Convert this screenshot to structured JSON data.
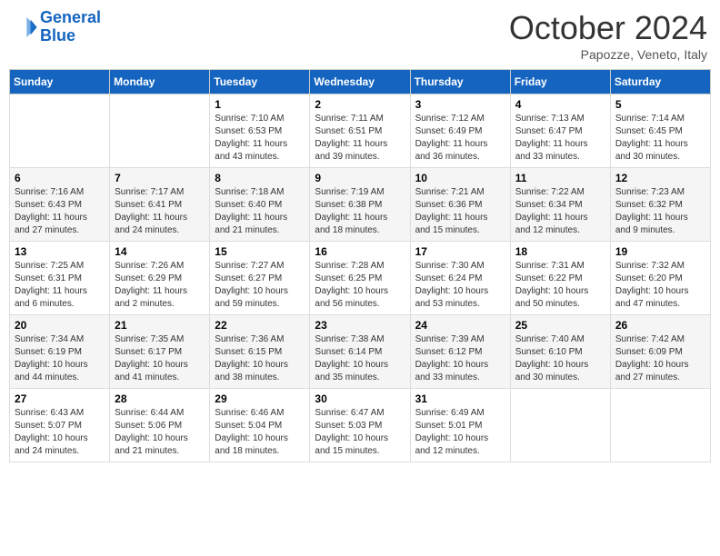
{
  "header": {
    "logo_general": "General",
    "logo_blue": "Blue",
    "month_title": "October 2024",
    "location": "Papozze, Veneto, Italy"
  },
  "days_of_week": [
    "Sunday",
    "Monday",
    "Tuesday",
    "Wednesday",
    "Thursday",
    "Friday",
    "Saturday"
  ],
  "weeks": [
    [
      {
        "day": "",
        "sunrise": "",
        "sunset": "",
        "daylight": ""
      },
      {
        "day": "",
        "sunrise": "",
        "sunset": "",
        "daylight": ""
      },
      {
        "day": "1",
        "sunrise": "Sunrise: 7:10 AM",
        "sunset": "Sunset: 6:53 PM",
        "daylight": "Daylight: 11 hours and 43 minutes."
      },
      {
        "day": "2",
        "sunrise": "Sunrise: 7:11 AM",
        "sunset": "Sunset: 6:51 PM",
        "daylight": "Daylight: 11 hours and 39 minutes."
      },
      {
        "day": "3",
        "sunrise": "Sunrise: 7:12 AM",
        "sunset": "Sunset: 6:49 PM",
        "daylight": "Daylight: 11 hours and 36 minutes."
      },
      {
        "day": "4",
        "sunrise": "Sunrise: 7:13 AM",
        "sunset": "Sunset: 6:47 PM",
        "daylight": "Daylight: 11 hours and 33 minutes."
      },
      {
        "day": "5",
        "sunrise": "Sunrise: 7:14 AM",
        "sunset": "Sunset: 6:45 PM",
        "daylight": "Daylight: 11 hours and 30 minutes."
      }
    ],
    [
      {
        "day": "6",
        "sunrise": "Sunrise: 7:16 AM",
        "sunset": "Sunset: 6:43 PM",
        "daylight": "Daylight: 11 hours and 27 minutes."
      },
      {
        "day": "7",
        "sunrise": "Sunrise: 7:17 AM",
        "sunset": "Sunset: 6:41 PM",
        "daylight": "Daylight: 11 hours and 24 minutes."
      },
      {
        "day": "8",
        "sunrise": "Sunrise: 7:18 AM",
        "sunset": "Sunset: 6:40 PM",
        "daylight": "Daylight: 11 hours and 21 minutes."
      },
      {
        "day": "9",
        "sunrise": "Sunrise: 7:19 AM",
        "sunset": "Sunset: 6:38 PM",
        "daylight": "Daylight: 11 hours and 18 minutes."
      },
      {
        "day": "10",
        "sunrise": "Sunrise: 7:21 AM",
        "sunset": "Sunset: 6:36 PM",
        "daylight": "Daylight: 11 hours and 15 minutes."
      },
      {
        "day": "11",
        "sunrise": "Sunrise: 7:22 AM",
        "sunset": "Sunset: 6:34 PM",
        "daylight": "Daylight: 11 hours and 12 minutes."
      },
      {
        "day": "12",
        "sunrise": "Sunrise: 7:23 AM",
        "sunset": "Sunset: 6:32 PM",
        "daylight": "Daylight: 11 hours and 9 minutes."
      }
    ],
    [
      {
        "day": "13",
        "sunrise": "Sunrise: 7:25 AM",
        "sunset": "Sunset: 6:31 PM",
        "daylight": "Daylight: 11 hours and 6 minutes."
      },
      {
        "day": "14",
        "sunrise": "Sunrise: 7:26 AM",
        "sunset": "Sunset: 6:29 PM",
        "daylight": "Daylight: 11 hours and 2 minutes."
      },
      {
        "day": "15",
        "sunrise": "Sunrise: 7:27 AM",
        "sunset": "Sunset: 6:27 PM",
        "daylight": "Daylight: 10 hours and 59 minutes."
      },
      {
        "day": "16",
        "sunrise": "Sunrise: 7:28 AM",
        "sunset": "Sunset: 6:25 PM",
        "daylight": "Daylight: 10 hours and 56 minutes."
      },
      {
        "day": "17",
        "sunrise": "Sunrise: 7:30 AM",
        "sunset": "Sunset: 6:24 PM",
        "daylight": "Daylight: 10 hours and 53 minutes."
      },
      {
        "day": "18",
        "sunrise": "Sunrise: 7:31 AM",
        "sunset": "Sunset: 6:22 PM",
        "daylight": "Daylight: 10 hours and 50 minutes."
      },
      {
        "day": "19",
        "sunrise": "Sunrise: 7:32 AM",
        "sunset": "Sunset: 6:20 PM",
        "daylight": "Daylight: 10 hours and 47 minutes."
      }
    ],
    [
      {
        "day": "20",
        "sunrise": "Sunrise: 7:34 AM",
        "sunset": "Sunset: 6:19 PM",
        "daylight": "Daylight: 10 hours and 44 minutes."
      },
      {
        "day": "21",
        "sunrise": "Sunrise: 7:35 AM",
        "sunset": "Sunset: 6:17 PM",
        "daylight": "Daylight: 10 hours and 41 minutes."
      },
      {
        "day": "22",
        "sunrise": "Sunrise: 7:36 AM",
        "sunset": "Sunset: 6:15 PM",
        "daylight": "Daylight: 10 hours and 38 minutes."
      },
      {
        "day": "23",
        "sunrise": "Sunrise: 7:38 AM",
        "sunset": "Sunset: 6:14 PM",
        "daylight": "Daylight: 10 hours and 35 minutes."
      },
      {
        "day": "24",
        "sunrise": "Sunrise: 7:39 AM",
        "sunset": "Sunset: 6:12 PM",
        "daylight": "Daylight: 10 hours and 33 minutes."
      },
      {
        "day": "25",
        "sunrise": "Sunrise: 7:40 AM",
        "sunset": "Sunset: 6:10 PM",
        "daylight": "Daylight: 10 hours and 30 minutes."
      },
      {
        "day": "26",
        "sunrise": "Sunrise: 7:42 AM",
        "sunset": "Sunset: 6:09 PM",
        "daylight": "Daylight: 10 hours and 27 minutes."
      }
    ],
    [
      {
        "day": "27",
        "sunrise": "Sunrise: 6:43 AM",
        "sunset": "Sunset: 5:07 PM",
        "daylight": "Daylight: 10 hours and 24 minutes."
      },
      {
        "day": "28",
        "sunrise": "Sunrise: 6:44 AM",
        "sunset": "Sunset: 5:06 PM",
        "daylight": "Daylight: 10 hours and 21 minutes."
      },
      {
        "day": "29",
        "sunrise": "Sunrise: 6:46 AM",
        "sunset": "Sunset: 5:04 PM",
        "daylight": "Daylight: 10 hours and 18 minutes."
      },
      {
        "day": "30",
        "sunrise": "Sunrise: 6:47 AM",
        "sunset": "Sunset: 5:03 PM",
        "daylight": "Daylight: 10 hours and 15 minutes."
      },
      {
        "day": "31",
        "sunrise": "Sunrise: 6:49 AM",
        "sunset": "Sunset: 5:01 PM",
        "daylight": "Daylight: 10 hours and 12 minutes."
      },
      {
        "day": "",
        "sunrise": "",
        "sunset": "",
        "daylight": ""
      },
      {
        "day": "",
        "sunrise": "",
        "sunset": "",
        "daylight": ""
      }
    ]
  ]
}
